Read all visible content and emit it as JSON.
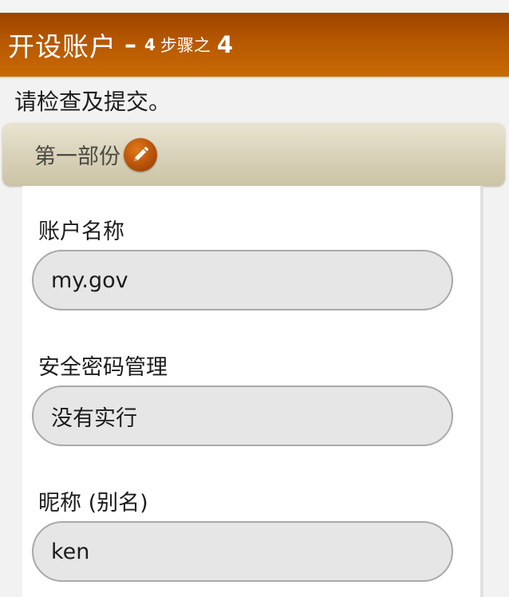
{
  "header": {
    "title": "开设账户",
    "dash": "–",
    "step_current": "4",
    "step_text": "步骤之",
    "step_total": "4",
    "colors": {
      "bar_top": "#9e4300",
      "bar_bottom": "#c96a06"
    }
  },
  "instruction": "请检查及提交。",
  "section": {
    "title": "第一部份",
    "edit_icon": "pencil-icon",
    "colors": {
      "bar": "#d8d1b8",
      "edit_button": "#b8520a"
    }
  },
  "fields": [
    {
      "label": "账户名称",
      "value": "my.gov"
    },
    {
      "label": "安全密码管理",
      "value": "没有实行"
    },
    {
      "label": "昵称 (别名)",
      "value": "ken"
    }
  ]
}
